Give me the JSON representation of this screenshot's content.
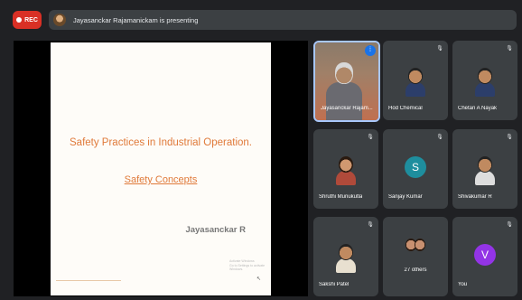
{
  "topbar": {
    "rec_label": "REC",
    "presenting_text": "Jayasanckar Rajamanickam is presenting"
  },
  "slide": {
    "title": "Safety Practices in Industrial Operation.",
    "subtitle": "Safety Concepts",
    "author": "Jayasanckar R",
    "watermark_line1": "Activate Windows",
    "watermark_line2": "Go to Settings to activate Windows."
  },
  "participants": [
    {
      "name": "Jayasanckar Rajam...",
      "speaking": true
    },
    {
      "name": "Hod Chemical",
      "muted": true
    },
    {
      "name": "Chetan A Nayak",
      "muted": true
    },
    {
      "name": "Shruthi Munukutla",
      "muted": true
    },
    {
      "name": "Sanjay Kumar",
      "muted": true,
      "initial": "S",
      "color": "#1e8e9e"
    },
    {
      "name": "Shivakumar R",
      "muted": true
    },
    {
      "name": "Sakshi Patel",
      "muted": true
    },
    {
      "name": "27 others"
    },
    {
      "name": "You",
      "initial": "V",
      "color": "#9334e6"
    }
  ],
  "colors": {
    "background": "#202124",
    "tile": "#3c4043",
    "rec": "#d93025",
    "slide_text": "#e07a3a"
  }
}
